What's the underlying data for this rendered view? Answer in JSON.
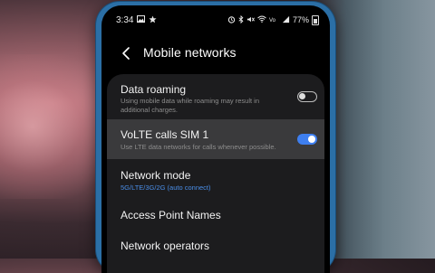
{
  "status_bar": {
    "time": "3:34",
    "left_icons": [
      "image-icon",
      "star-icon"
    ],
    "right_icons": [
      "alarm-icon",
      "bluetooth-icon",
      "mute-icon",
      "wifi-icon",
      "volte-icon",
      "signal-icon"
    ],
    "battery": "77%"
  },
  "header": {
    "back_icon": "back-arrow-icon",
    "title": "Mobile networks"
  },
  "settings": [
    {
      "label": "Data roaming",
      "description": "Using mobile data while roaming may result in additional charges.",
      "toggle": "off"
    },
    {
      "label": "VoLTE calls SIM 1",
      "description": "Use LTE data networks for calls whenever possible.",
      "toggle": "on",
      "highlighted": true
    },
    {
      "label": "Network mode",
      "value": "5G/LTE/3G/2G (auto connect)"
    },
    {
      "label": "Access Point Names"
    },
    {
      "label": "Network operators"
    }
  ],
  "colors": {
    "accent": "#3e7ff0",
    "value_text": "#4a8ee8",
    "card_bg": "#1c1c1e",
    "highlight_bg": "#3a3a3c",
    "phone_frame": "#2b6fa6"
  }
}
